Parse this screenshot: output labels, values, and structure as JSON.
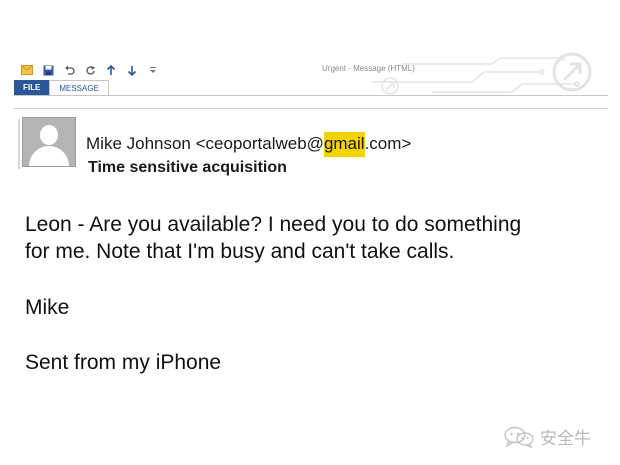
{
  "window": {
    "title": "Urgent - Message (HTML)"
  },
  "quick_access": {
    "icons": [
      "mail-icon",
      "save-icon",
      "undo-icon",
      "redo-icon",
      "up-arrow-icon",
      "down-arrow-icon",
      "customize-icon"
    ]
  },
  "ribbon": {
    "tabs": [
      {
        "label": "FILE"
      },
      {
        "label": "MESSAGE"
      }
    ]
  },
  "message": {
    "sender_name": "Mike Johnson",
    "sender_email_prefix": "<ceoportalweb@",
    "sender_email_highlight": "gmail",
    "sender_email_suffix": ".com>",
    "subject": "Time sensitive acquisition",
    "body_lines": [
      "Leon - Are you available? I need you to do something",
      "for me. Note that I'm busy and can't take calls.",
      "Mike",
      "Sent from my iPhone"
    ]
  },
  "watermark": {
    "text": "安全牛"
  },
  "colors": {
    "file_tab": "#2b579a",
    "highlight": "#f2d300",
    "text": "#111111",
    "muted": "#8a8a8a"
  }
}
